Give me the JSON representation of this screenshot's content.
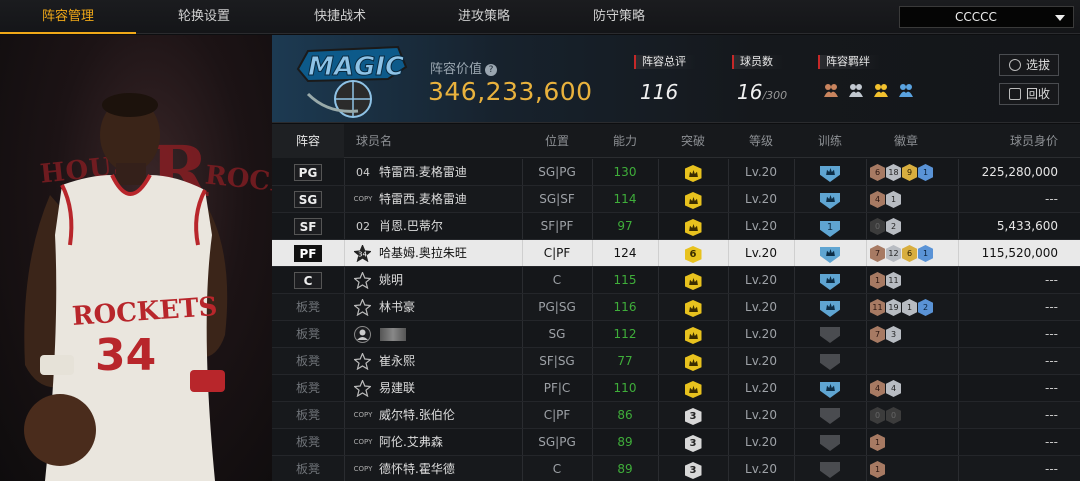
{
  "nav": {
    "tabs": [
      "阵容管理",
      "轮换设置",
      "快捷战术",
      "进攻策略",
      "防守策略"
    ],
    "active_tab": 0,
    "dropdown_value": "CCCCC"
  },
  "art": {
    "wordmark_left": "HOUS",
    "wordmark_right": "ROCK",
    "jersey_team": "ROCKETS",
    "jersey_number": "34"
  },
  "summary": {
    "value_label": "阵容价值",
    "value_help": "?",
    "value": "346,233,600",
    "overall_label": "阵容总评",
    "overall": "116",
    "count_label": "球员数",
    "count": "16",
    "count_max": "/300",
    "chem_label": "阵容羁绊",
    "btn_pick": "选拔",
    "btn_recycle": "回收",
    "team_logo_text": "MAGIC",
    "accent": "#e9b23d"
  },
  "table": {
    "headers": [
      "阵容",
      "球员名",
      "位置",
      "能力",
      "突破",
      "等级",
      "训练",
      "徽章",
      "球员身价"
    ],
    "rows": [
      {
        "slot": "PG",
        "slot_type": "starter",
        "num": "04",
        "num_type": "number",
        "name": "特雷西.麦格雷迪",
        "pos": "SG|PG",
        "ability": "130",
        "break": "crown",
        "level": "Lv.20",
        "train": "crown",
        "badges": [
          [
            "bronze",
            "6"
          ],
          [
            "silver",
            "18"
          ],
          [
            "gold",
            "9"
          ],
          [
            "blue",
            "1"
          ]
        ],
        "value": "225,280,000"
      },
      {
        "slot": "SG",
        "slot_type": "starter",
        "num": "COPY",
        "num_type": "copy",
        "name": "特雷西.麦格雷迪",
        "pos": "SG|SF",
        "ability": "114",
        "break": "crown",
        "level": "Lv.20",
        "train": "crown",
        "badges": [
          [
            "bronze",
            "4"
          ],
          [
            "silver",
            "1"
          ]
        ],
        "value": "---"
      },
      {
        "slot": "SF",
        "slot_type": "starter",
        "num": "02",
        "num_type": "number",
        "name": "肖恩.巴蒂尔",
        "pos": "SF|PF",
        "ability": "97",
        "break": "crown",
        "level": "Lv.20",
        "train": "1",
        "badges": [
          [
            "dark",
            "0"
          ],
          [
            "silver",
            "2"
          ]
        ],
        "value": "5,433,600"
      },
      {
        "slot": "PF",
        "slot_type": "selected",
        "num": "34",
        "num_type": "star",
        "name": "哈基姆.奥拉朱旺",
        "pos": "C|PF",
        "ability": "124",
        "break": "6",
        "level": "Lv.20",
        "train": "crown",
        "badges": [
          [
            "bronze",
            "7"
          ],
          [
            "silver",
            "12"
          ],
          [
            "gold",
            "6"
          ],
          [
            "blue",
            "1"
          ]
        ],
        "value": "115,520,000"
      },
      {
        "slot": "C",
        "slot_type": "starter",
        "num": "",
        "num_type": "star",
        "name": "姚明",
        "pos": "C",
        "ability": "115",
        "break": "crown",
        "level": "Lv.20",
        "train": "crown",
        "badges": [
          [
            "bronze",
            "1"
          ],
          [
            "silver",
            "11"
          ]
        ],
        "value": "---"
      },
      {
        "slot": "板凳",
        "slot_type": "bench",
        "num": "",
        "num_type": "star",
        "name": "林书豪",
        "pos": "PG|SG",
        "ability": "116",
        "break": "crown",
        "level": "Lv.20",
        "train": "crown",
        "badges": [
          [
            "bronze",
            "11"
          ],
          [
            "silver",
            "19"
          ],
          [
            "silver",
            "1"
          ],
          [
            "blue",
            "2"
          ]
        ],
        "value": "---"
      },
      {
        "slot": "板凳",
        "slot_type": "bench",
        "num": "",
        "num_type": "avatar",
        "name": "",
        "pos": "SG",
        "ability": "112",
        "break": "crown",
        "level": "Lv.20",
        "train": "dim",
        "badges": [
          [
            "bronze",
            "7"
          ],
          [
            "silver",
            "3"
          ]
        ],
        "value": "---"
      },
      {
        "slot": "板凳",
        "slot_type": "bench",
        "num": "",
        "num_type": "star",
        "name": "崔永熙",
        "pos": "SF|SG",
        "ability": "77",
        "break": "crown",
        "level": "Lv.20",
        "train": "dim",
        "badges": [],
        "value": "---"
      },
      {
        "slot": "板凳",
        "slot_type": "bench",
        "num": "",
        "num_type": "star",
        "name": "易建联",
        "pos": "PF|C",
        "ability": "110",
        "break": "crown",
        "level": "Lv.20",
        "train": "crown",
        "badges": [
          [
            "bronze",
            "4"
          ],
          [
            "silver",
            "4"
          ]
        ],
        "value": "---"
      },
      {
        "slot": "板凳",
        "slot_type": "bench",
        "num": "COPY",
        "num_type": "copy",
        "name": "威尔特.张伯伦",
        "pos": "C|PF",
        "ability": "86",
        "break": "3",
        "level": "Lv.20",
        "train": "dim",
        "badges": [
          [
            "dark",
            "0"
          ],
          [
            "dark",
            "0"
          ]
        ],
        "value": "---"
      },
      {
        "slot": "板凳",
        "slot_type": "bench",
        "num": "COPY",
        "num_type": "copy",
        "name": "阿伦.艾弗森",
        "pos": "SG|PG",
        "ability": "89",
        "break": "3",
        "level": "Lv.20",
        "train": "dim",
        "badges": [
          [
            "bronze",
            "1"
          ]
        ],
        "value": "---"
      },
      {
        "slot": "板凳",
        "slot_type": "bench",
        "num": "COPY",
        "num_type": "copy",
        "name": "德怀特.霍华德",
        "pos": "C",
        "ability": "89",
        "break": "3",
        "level": "Lv.20",
        "train": "dim",
        "badges": [
          [
            "bronze",
            "1"
          ]
        ],
        "value": "---"
      }
    ]
  }
}
